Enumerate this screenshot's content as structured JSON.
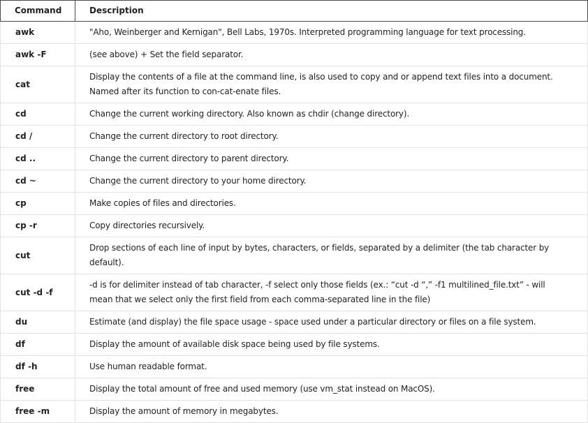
{
  "table": {
    "headers": {
      "command": "Command",
      "description": "Description"
    },
    "rows": [
      {
        "command": "awk",
        "description": "\"Aho, Weinberger and Kernigan\", Bell Labs, 1970s. Interpreted programming language for text processing."
      },
      {
        "command": "awk -F",
        "description": "(see above) + Set the field separator."
      },
      {
        "command": "cat",
        "description": "Display the contents of a file at the command line, is also used to copy and or append text files into a document. Named after its function to con-cat-enate files."
      },
      {
        "command": "cd",
        "description": "Change the current working directory. Also known as chdir (change directory)."
      },
      {
        "command": "cd /",
        "description": "Change the current directory to root directory."
      },
      {
        "command": "cd ..",
        "description": "Change the current directory to parent directory."
      },
      {
        "command": "cd ~",
        "description": "Change the current directory to your home directory."
      },
      {
        "command": "cp",
        "description": "Make copies of files and directories."
      },
      {
        "command": "cp -r",
        "description": "Copy directories recursively."
      },
      {
        "command": "cut",
        "description": "Drop sections of each line of input by bytes, characters, or fields, separated by a delimiter (the tab character by default)."
      },
      {
        "command": "cut -d -f",
        "description": "-d is for delimiter instead of tab character, -f select only those fields (ex.: “cut -d “,” -f1 multilined_file.txt” - will mean that we select only the first field from each comma-separated line in the file)"
      },
      {
        "command": "du",
        "description": "Estimate (and display) the file space usage - space used under a particular directory or files on a file system."
      },
      {
        "command": "df",
        "description": "Display the amount of available disk space being used by file systems."
      },
      {
        "command": "df -h",
        "description": "Use human readable format."
      },
      {
        "command": "free",
        "description": "Display the total amount of free and used memory (use vm_stat instead on MacOS)."
      },
      {
        "command": "free -m",
        "description": "Display the amount of memory in megabytes."
      }
    ]
  }
}
